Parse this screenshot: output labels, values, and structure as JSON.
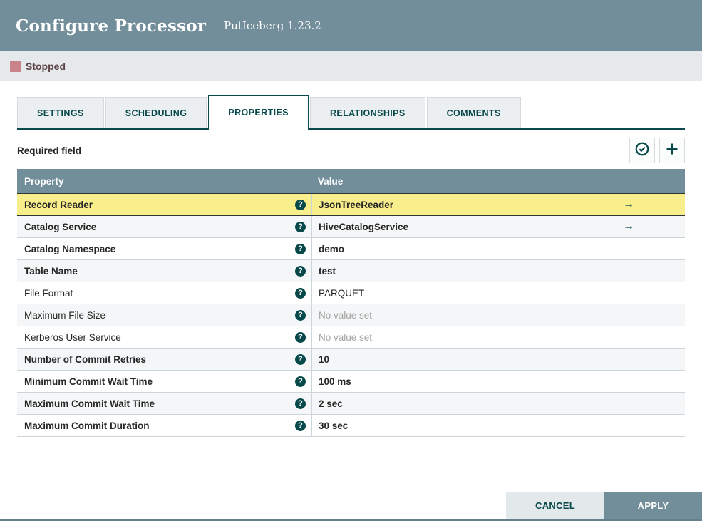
{
  "header": {
    "title": "Configure Processor",
    "subtitle": "PutIceberg 1.23.2"
  },
  "status": {
    "label": "Stopped",
    "color": "#c9848b"
  },
  "tabs": [
    {
      "label": "SETTINGS",
      "active": false
    },
    {
      "label": "SCHEDULING",
      "active": false
    },
    {
      "label": "PROPERTIES",
      "active": true
    },
    {
      "label": "RELATIONSHIPS",
      "active": false
    },
    {
      "label": "COMMENTS",
      "active": false
    }
  ],
  "toolbar": {
    "required_label": "Required field",
    "icons": [
      "verify-properties-icon",
      "add-property-icon"
    ]
  },
  "table": {
    "columns": {
      "property": "Property",
      "value": "Value"
    },
    "rows": [
      {
        "property": "Record Reader",
        "value": "JsonTreeReader",
        "required": true,
        "placeholder": false,
        "has_arrow": true,
        "selected": true
      },
      {
        "property": "Catalog Service",
        "value": "HiveCatalogService",
        "required": true,
        "placeholder": false,
        "has_arrow": true,
        "selected": false
      },
      {
        "property": "Catalog Namespace",
        "value": "demo",
        "required": true,
        "placeholder": false,
        "has_arrow": false,
        "selected": false
      },
      {
        "property": "Table Name",
        "value": "test",
        "required": true,
        "placeholder": false,
        "has_arrow": false,
        "selected": false
      },
      {
        "property": "File Format",
        "value": "PARQUET",
        "required": false,
        "placeholder": false,
        "has_arrow": false,
        "selected": false
      },
      {
        "property": "Maximum File Size",
        "value": "No value set",
        "required": false,
        "placeholder": true,
        "has_arrow": false,
        "selected": false
      },
      {
        "property": "Kerberos User Service",
        "value": "No value set",
        "required": false,
        "placeholder": true,
        "has_arrow": false,
        "selected": false
      },
      {
        "property": "Number of Commit Retries",
        "value": "10",
        "required": true,
        "placeholder": false,
        "has_arrow": false,
        "selected": false
      },
      {
        "property": "Minimum Commit Wait Time",
        "value": "100 ms",
        "required": true,
        "placeholder": false,
        "has_arrow": false,
        "selected": false
      },
      {
        "property": "Maximum Commit Wait Time",
        "value": "2 sec",
        "required": true,
        "placeholder": false,
        "has_arrow": false,
        "selected": false
      },
      {
        "property": "Maximum Commit Duration",
        "value": "30 sec",
        "required": true,
        "placeholder": false,
        "has_arrow": false,
        "selected": false
      }
    ]
  },
  "footer": {
    "cancel_label": "CANCEL",
    "apply_label": "APPLY"
  },
  "colors": {
    "header_bg": "#728e9b",
    "accent_teal": "#07484a",
    "selected_row_bg": "#f8ee8b",
    "status_stopped": "#c9848b",
    "statusbar_bg": "#e5e9ec",
    "apply_bg": "#728e9b",
    "cancel_bg": "#e3e8eb"
  }
}
